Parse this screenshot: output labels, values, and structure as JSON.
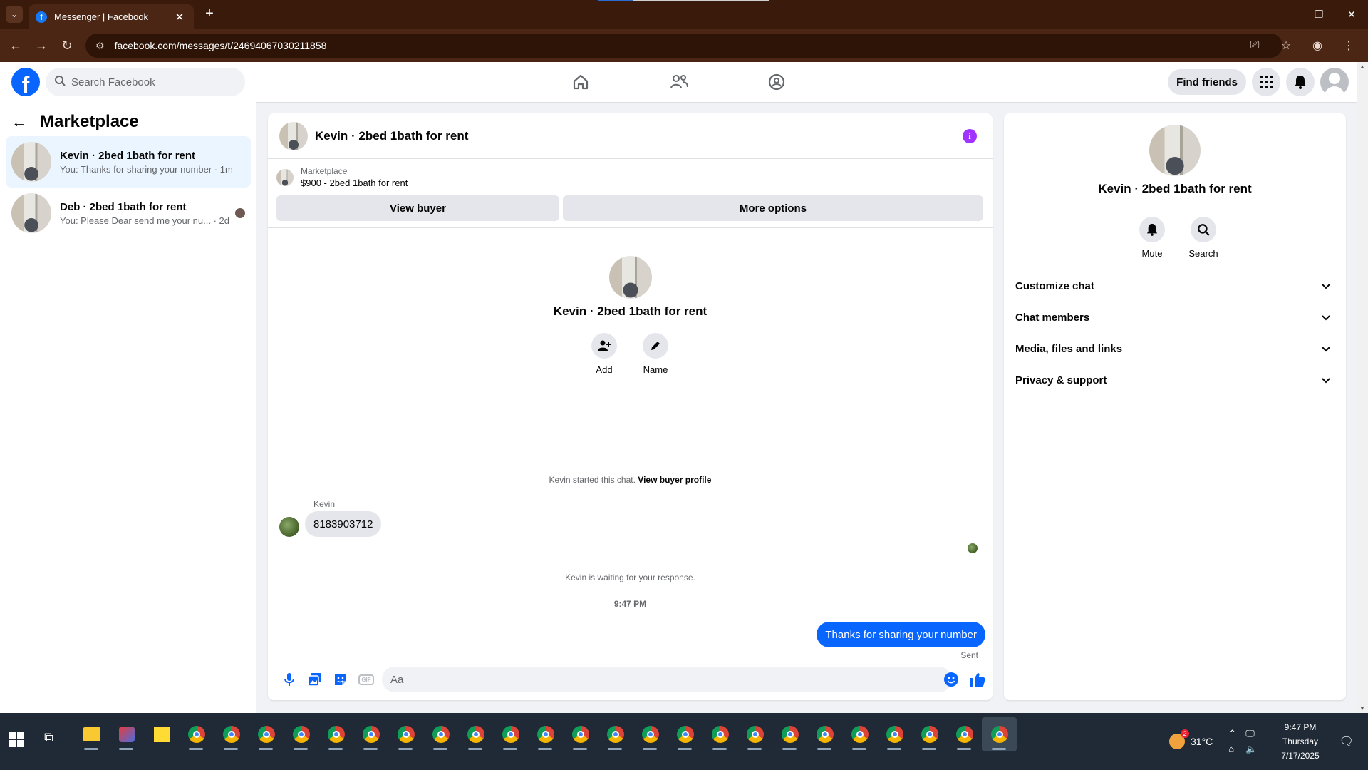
{
  "browser": {
    "tab_title": "Messenger | Facebook",
    "tab_close": "✕",
    "new_tab": "+",
    "url": "facebook.com/messages/t/24694067030211858"
  },
  "fb": {
    "search_placeholder": "Search Facebook",
    "find_friends": "Find friends"
  },
  "sidebar": {
    "title": "Marketplace",
    "conversations": [
      {
        "name": "Kevin · 2bed 1bath for rent",
        "preview": "You: Thanks for sharing your number · 1m"
      },
      {
        "name": "Deb · 2bed 1bath for rent",
        "preview": "You: Please Dear send me your nu... · 2d"
      }
    ]
  },
  "chat": {
    "title": "Kevin · 2bed 1bath for rent",
    "listing_label": "Marketplace",
    "listing_detail": "$900 - 2bed 1bath for rent",
    "view_buyer": "View buyer",
    "more_options": "More options",
    "profile_name": "Kevin · 2bed 1bath for rent",
    "add_label": "Add",
    "name_label": "Name",
    "started_text": "Kevin started this chat.",
    "view_buyer_profile": "View buyer profile",
    "sender_name": "Kevin",
    "incoming_message": "8183903712",
    "waiting_text": "Kevin is waiting for your response.",
    "timestamp": "9:47 PM",
    "outgoing_message": "Thanks for sharing your number",
    "sent_status": "Sent",
    "composer_placeholder": "Aa"
  },
  "rpanel": {
    "name": "Kevin · 2bed 1bath for rent",
    "mute_label": "Mute",
    "search_label": "Search",
    "sections": [
      "Customize chat",
      "Chat members",
      "Media, files and links",
      "Privacy & support"
    ]
  },
  "taskbar": {
    "temperature": "31°C",
    "weather_badge": "2",
    "time": "9:47 PM",
    "day": "Thursday",
    "date": "7/17/2025"
  },
  "colors": {
    "accent": "#0866ff",
    "browser_frame": "#3a1b0b",
    "info": "#a033ff"
  }
}
